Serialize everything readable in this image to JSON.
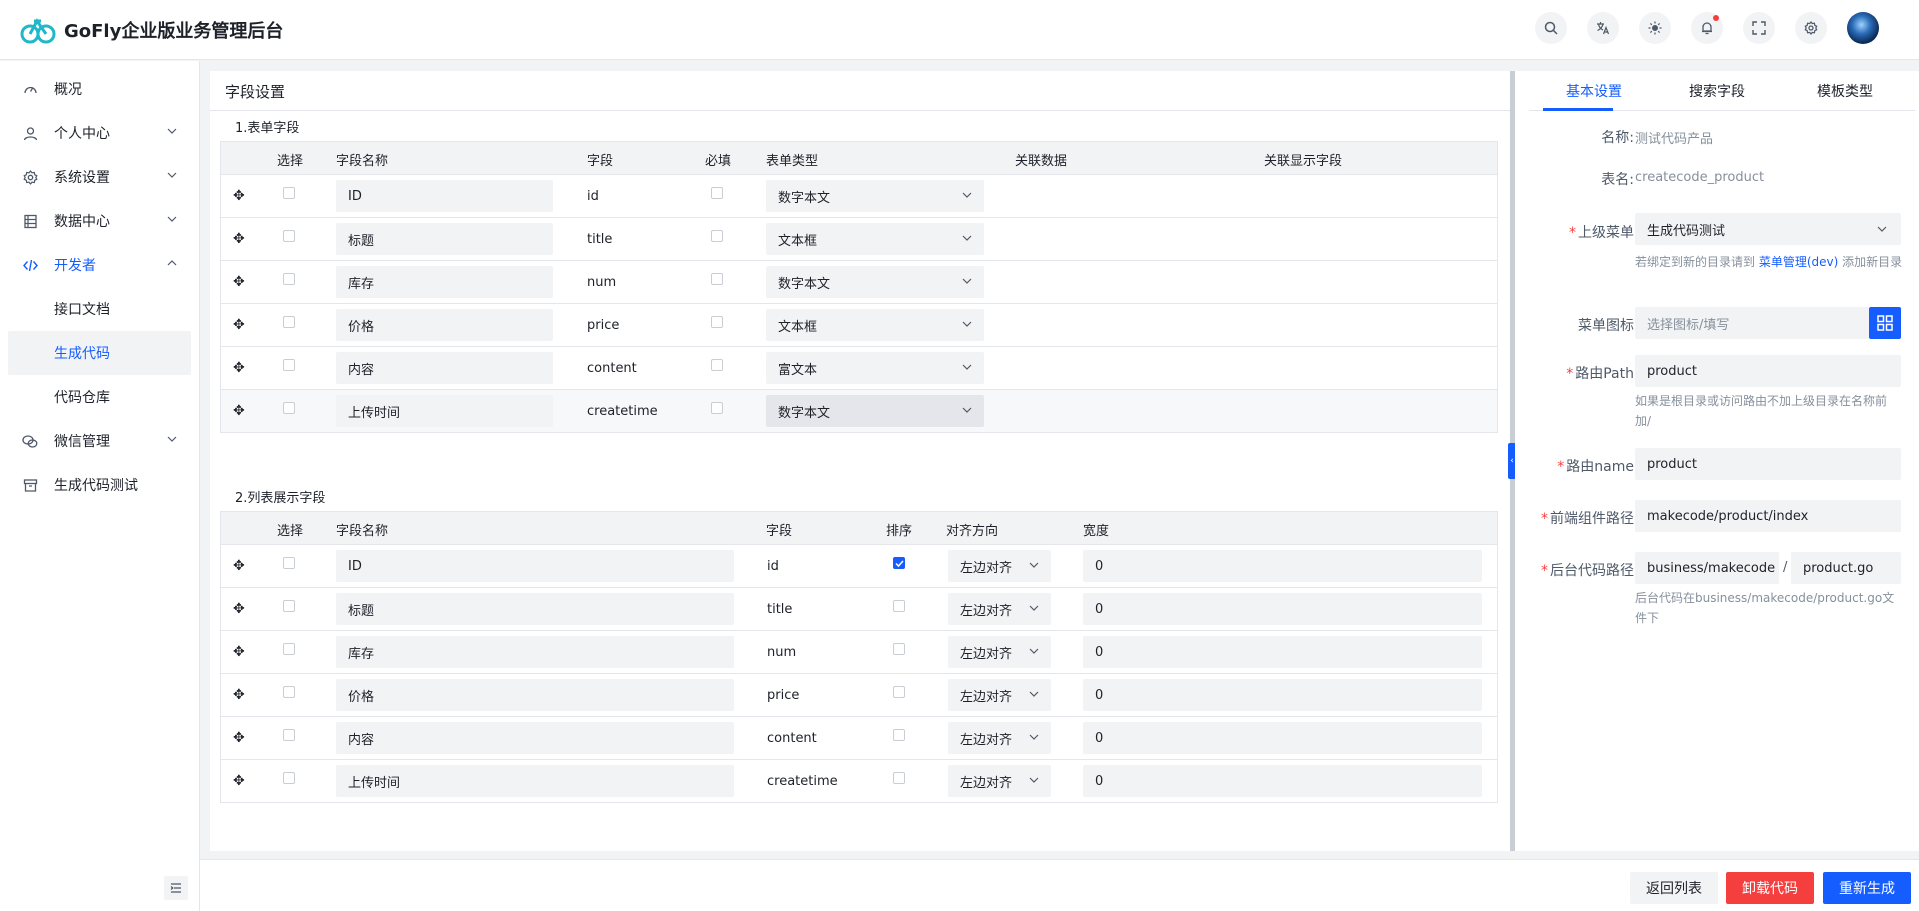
{
  "app": {
    "title": "GoFly企业版业务管理后台"
  },
  "header_tools": [
    "search-icon",
    "translate-icon",
    "theme-icon",
    "notification-icon",
    "fullscreen-icon",
    "settings-icon"
  ],
  "sidebar": {
    "items": [
      {
        "label": "概况",
        "icon": "dashboard-icon"
      },
      {
        "label": "个人中心",
        "icon": "user-icon"
      },
      {
        "label": "系统设置",
        "icon": "gear-icon"
      },
      {
        "label": "数据中心",
        "icon": "database-icon"
      },
      {
        "label": "开发者",
        "icon": "code-icon"
      },
      {
        "label": "微信管理",
        "icon": "wechat-icon"
      },
      {
        "label": "生成代码测试",
        "icon": "archive-icon"
      }
    ],
    "dev_children": [
      "接口文档",
      "生成代码",
      "代码仓库"
    ]
  },
  "main": {
    "title": "字段设置",
    "form_section": {
      "title": "1.表单字段",
      "headers": [
        "选择",
        "字段名称",
        "字段",
        "必填",
        "表单类型",
        "关联数据",
        "关联显示字段"
      ],
      "rows": [
        {
          "name": "ID",
          "field": "id",
          "type": "数字本文"
        },
        {
          "name": "标题",
          "field": "title",
          "type": "文本框"
        },
        {
          "name": "库存",
          "field": "num",
          "type": "数字本文"
        },
        {
          "name": "价格",
          "field": "price",
          "type": "文本框"
        },
        {
          "name": "内容",
          "field": "content",
          "type": "富文本"
        },
        {
          "name": "上传时间",
          "field": "createtime",
          "type": "数字本文"
        }
      ]
    },
    "list_section": {
      "title": "2.列表展示字段",
      "headers": [
        "选择",
        "字段名称",
        "字段",
        "排序",
        "对齐方向",
        "宽度"
      ],
      "rows": [
        {
          "name": "ID",
          "field": "id",
          "sort": true,
          "align": "左边对齐",
          "width": "0"
        },
        {
          "name": "标题",
          "field": "title",
          "sort": false,
          "align": "左边对齐",
          "width": "0"
        },
        {
          "name": "库存",
          "field": "num",
          "sort": false,
          "align": "左边对齐",
          "width": "0"
        },
        {
          "name": "价格",
          "field": "price",
          "sort": false,
          "align": "左边对齐",
          "width": "0"
        },
        {
          "name": "内容",
          "field": "content",
          "sort": false,
          "align": "左边对齐",
          "width": "0"
        },
        {
          "name": "上传时间",
          "field": "createtime",
          "sort": false,
          "align": "左边对齐",
          "width": "0"
        }
      ]
    }
  },
  "panel": {
    "tabs": [
      "基本设置",
      "搜索字段",
      "模板类型"
    ],
    "name_label": "名称:",
    "name_value": "测试代码产品",
    "table_label": "表名:",
    "table_value": "createcode_product",
    "parent_menu_label": "上级菜单",
    "parent_menu_value": "生成代码测试",
    "parent_menu_help_1": "若绑定到新的目录请到",
    "parent_menu_help_link": "菜单管理(dev)",
    "parent_menu_help_2": "添加新目录",
    "menu_icon_label": "菜单图标",
    "menu_icon_placeholder": "选择图标/填写",
    "route_path_label": "路由Path",
    "route_path_value": "product",
    "route_path_help": "如果是根目录或访问路由不加上级目录在名称前加/",
    "route_name_label": "路由name",
    "route_name_value": "product",
    "frontend_path_label": "前端组件路径",
    "frontend_path_value": "makecode/product/index",
    "backend_path_label": "后台代码路径",
    "backend_path_dir": "business/makecode",
    "backend_path_sep": "/",
    "backend_path_file": "product.go",
    "backend_path_help": "后台代码在business/makecode/product.go文件下"
  },
  "footer": {
    "back": "返回列表",
    "uninstall": "卸载代码",
    "regenerate": "重新生成"
  },
  "colors": {
    "primary": "#165dff",
    "danger": "#f53f3f",
    "brand": "#1fb8c8"
  }
}
